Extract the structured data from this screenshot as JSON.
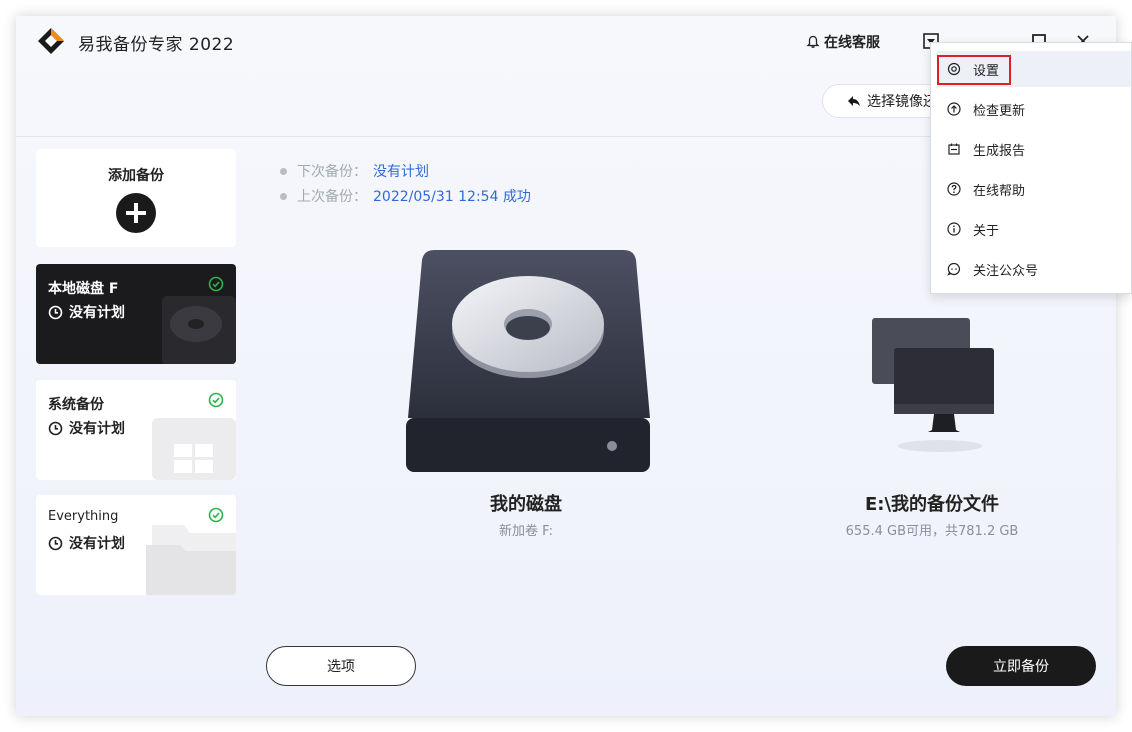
{
  "app": {
    "title": "易我备份专家 2022"
  },
  "header": {
    "support_label": "在线客服",
    "select_image_label": "选择镜像还原"
  },
  "sidebar": {
    "add_label": "添加备份",
    "tasks": [
      {
        "title": "本地磁盘 F",
        "schedule": "没有计划",
        "active": true
      },
      {
        "title": "系统备份",
        "schedule": "没有计划",
        "active": false
      },
      {
        "title": "Everything",
        "schedule": "没有计划",
        "active": false
      }
    ]
  },
  "status": {
    "next_key": "下次备份：",
    "next_val": "没有计划",
    "last_key": "上次备份：",
    "last_val": "2022/05/31 12:54 成功"
  },
  "source": {
    "name": "我的磁盘",
    "sub": "新加卷 F:"
  },
  "destination": {
    "name": "E:\\我的备份文件",
    "sub": "655.4 GB可用，共781.2 GB"
  },
  "buttons": {
    "options": "选项",
    "backup_now": "立即备份"
  },
  "menu": {
    "items": [
      {
        "label": "设置",
        "icon": "gear-icon"
      },
      {
        "label": "检查更新",
        "icon": "arrow-up-icon"
      },
      {
        "label": "生成报告",
        "icon": "calendar-icon"
      },
      {
        "label": "在线帮助",
        "icon": "question-icon"
      },
      {
        "label": "关于",
        "icon": "info-icon"
      },
      {
        "label": "关注公众号",
        "icon": "chat-icon"
      }
    ]
  },
  "colors": {
    "accent": "#2f6bd6",
    "dark": "#1b1b1d",
    "success": "#2db24a",
    "highlight": "#e02020"
  }
}
